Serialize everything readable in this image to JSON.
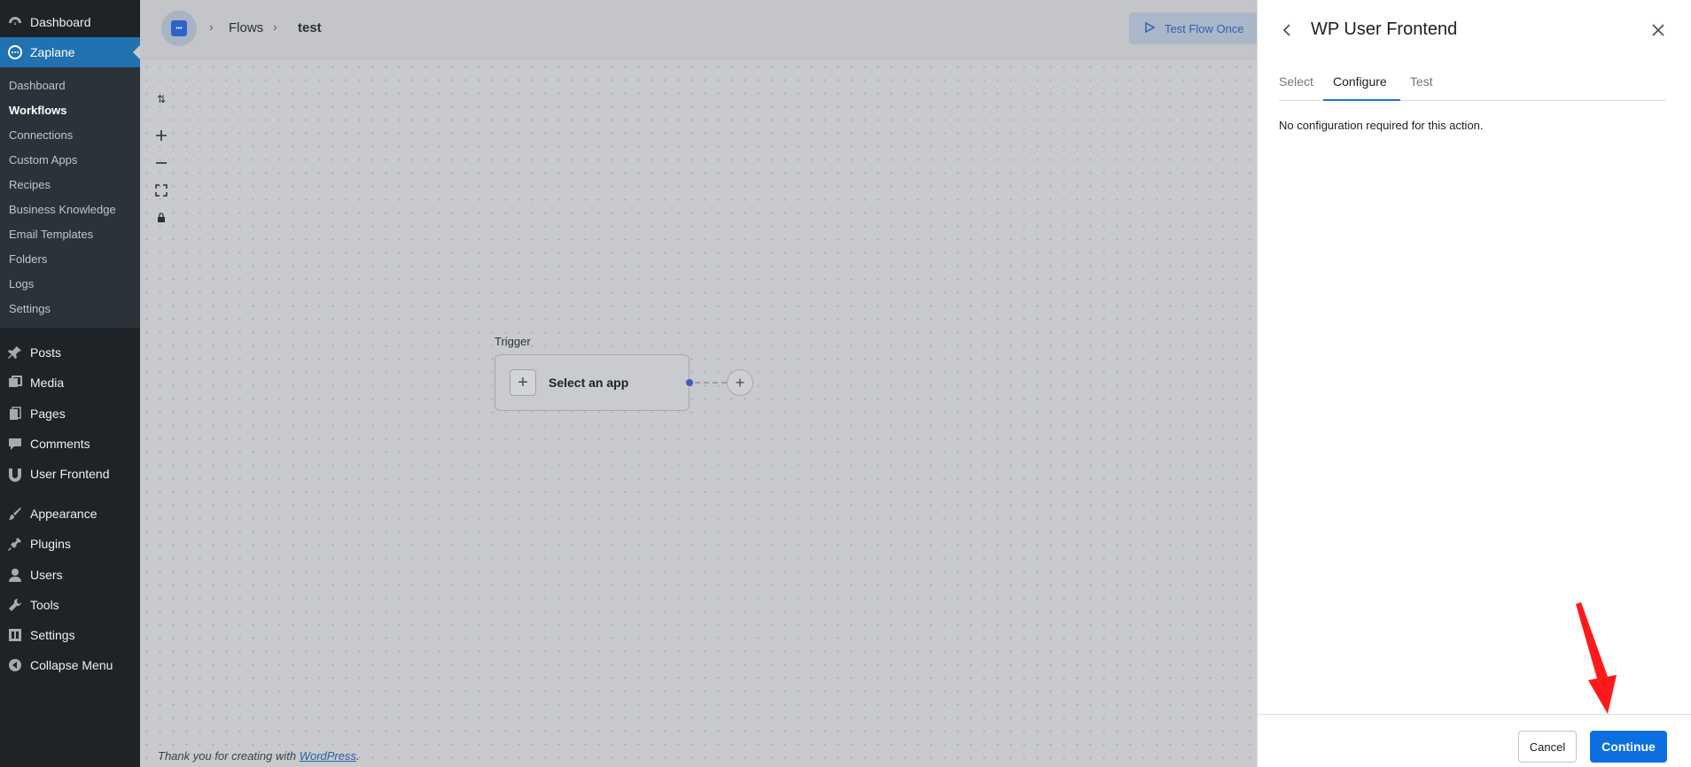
{
  "wp_menu": {
    "dashboard": "Dashboard",
    "zaplane": "Zaplane",
    "submenu": [
      "Dashboard",
      "Workflows",
      "Connections",
      "Custom Apps",
      "Recipes",
      "Business Knowledge",
      "Email Templates",
      "Folders",
      "Logs",
      "Settings"
    ],
    "current_submenu": "Workflows",
    "items": [
      "Posts",
      "Media",
      "Pages",
      "Comments",
      "User Frontend",
      "Appearance",
      "Plugins",
      "Users",
      "Tools",
      "Settings",
      "Collapse Menu"
    ]
  },
  "header": {
    "breadcrumb_flows": "Flows",
    "breadcrumb_current": "test",
    "test_flow_label": "Test Flow Once"
  },
  "canvas": {
    "trigger_label": "Trigger",
    "select_app": "Select an app",
    "footer_prefix": "Thank you for creating with ",
    "footer_link": "WordPress",
    "footer_suffix": "."
  },
  "panel": {
    "title": "WP User Frontend",
    "tabs": [
      "Select",
      "Configure",
      "Test"
    ],
    "active_tab": "Configure",
    "message": "No configuration required for this action.",
    "cancel_label": "Cancel",
    "continue_label": "Continue"
  },
  "colors": {
    "wp_sidebar": "#1d2327",
    "wp_active": "#2271b1",
    "primary_button": "#0b6fe0",
    "tab_underline": "#1976d2",
    "annotation_arrow": "#ff1a1a"
  }
}
